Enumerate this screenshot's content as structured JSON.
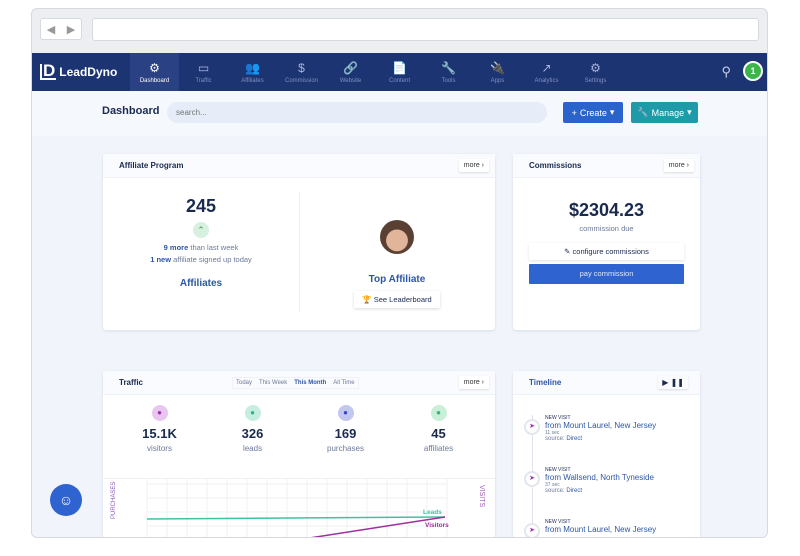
{
  "browser": {
    "back": "◀",
    "forward": "▶"
  },
  "nav": {
    "brand": "LeadDyno",
    "logo_mark": "D",
    "items": [
      {
        "label": "Dashboard",
        "icon": "⚙"
      },
      {
        "label": "Traffic",
        "icon": "▭"
      },
      {
        "label": "Affiliates",
        "icon": "👥"
      },
      {
        "label": "Commission",
        "icon": "$"
      },
      {
        "label": "Website",
        "icon": "🔗"
      },
      {
        "label": "Content",
        "icon": "📄"
      },
      {
        "label": "Tools",
        "icon": "🔧"
      },
      {
        "label": "Apps",
        "icon": "🔌"
      },
      {
        "label": "Analytics",
        "icon": "↗"
      },
      {
        "label": "Settings",
        "icon": "⚙"
      }
    ],
    "avatar": "1"
  },
  "sub": {
    "title": "Dashboard",
    "search_placeholder": "search...",
    "create": "Create",
    "manage": "Manage"
  },
  "affiliate": {
    "title": "Affiliate Program",
    "more": "more",
    "count": "245",
    "more_num": "9 more",
    "more_text": "than last week",
    "new_num": "1 new",
    "new_text": "affiliate signed up today",
    "label": "Affiliates",
    "top": "Top Affiliate",
    "leaderboard": "See Leaderboard"
  },
  "commissions": {
    "title": "Commissions",
    "more": "more",
    "amount": "$2304.23",
    "due": "commission due",
    "configure": "configure commissions",
    "pay": "pay commission"
  },
  "traffic": {
    "title": "Traffic",
    "more": "more",
    "ranges": [
      "Today",
      "This Week",
      "This Month",
      "All Time"
    ],
    "stats": [
      {
        "value": "15.1K",
        "label": "visitors",
        "color": "#e9c6ef",
        "fg": "#9b2fae"
      },
      {
        "value": "326",
        "label": "leads",
        "color": "#c5eee0",
        "fg": "#2fb38a"
      },
      {
        "value": "169",
        "label": "purchases",
        "color": "#c2c7f0",
        "fg": "#3b46b5"
      },
      {
        "value": "45",
        "label": "affiliates",
        "color": "#c9efd9",
        "fg": "#36b37a"
      }
    ],
    "chart": {
      "left_axis": "PURCHASES",
      "right_axis": "VISITS",
      "leads": "Leads",
      "visitors": "Visitors"
    }
  },
  "timeline": {
    "title": "Timeline",
    "events": [
      {
        "type": "NEW VISIT",
        "from": "from Mount Laurel, New Jersey",
        "time": "11 sec",
        "source_label": "source:",
        "source": "Direct"
      },
      {
        "type": "NEW VISIT",
        "from": "from Wallsend, North Tyneside",
        "time": "37 sec",
        "source_label": "source:",
        "source": "Direct"
      },
      {
        "type": "NEW VISIT",
        "from": "from Mount Laurel, New Jersey",
        "time": "",
        "source_label": "",
        "source": ""
      }
    ]
  }
}
